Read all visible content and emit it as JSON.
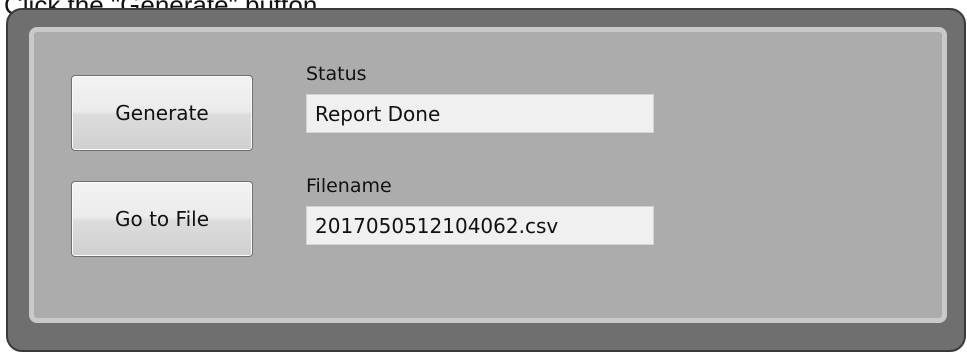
{
  "instruction": "Click the \"Generate\" button.",
  "buttons": {
    "generate_label": "Generate",
    "goto_file_label": "Go to File"
  },
  "status": {
    "label": "Status",
    "value": "Report Done"
  },
  "filename": {
    "label": "Filename",
    "value": "2017050512104062.csv"
  }
}
